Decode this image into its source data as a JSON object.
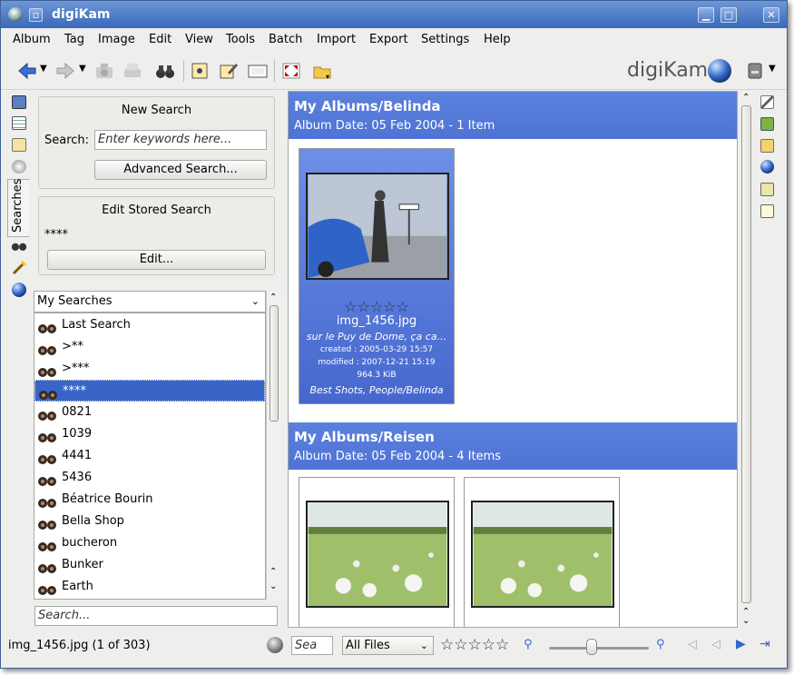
{
  "window": {
    "title": "digiKam"
  },
  "menu": [
    "Album",
    "Tag",
    "Image",
    "Edit",
    "View",
    "Tools",
    "Batch",
    "Import",
    "Export",
    "Settings",
    "Help"
  ],
  "logo": "digiKam",
  "new_search": {
    "title": "New Search",
    "search_label": "Search:",
    "search_placeholder": "Enter keywords here...",
    "advanced_button": "Advanced Search..."
  },
  "stored_search": {
    "title": "Edit Stored Search",
    "name": "****",
    "edit_button": "Edit..."
  },
  "sidebar_tab": "Searches",
  "searches_combo": "My Searches",
  "search_items": [
    {
      "label": "Last Search",
      "selected": false
    },
    {
      "label": ">**",
      "selected": false
    },
    {
      "label": ">***",
      "selected": false
    },
    {
      "label": "****",
      "selected": true
    },
    {
      "label": "0821",
      "selected": false
    },
    {
      "label": "1039",
      "selected": false
    },
    {
      "label": "4441",
      "selected": false
    },
    {
      "label": "5436",
      "selected": false
    },
    {
      "label": "Béatrice Bourin",
      "selected": false
    },
    {
      "label": "Bella Shop",
      "selected": false
    },
    {
      "label": "bucheron",
      "selected": false
    },
    {
      "label": "Bunker",
      "selected": false
    },
    {
      "label": "Earth",
      "selected": false
    }
  ],
  "filter_placeholder": "Search...",
  "albums": [
    {
      "title": "My Albums/Belinda",
      "date": "Album Date: 05 Feb 2004 - 1 Item",
      "item": {
        "filename": "img_1456.jpg",
        "comment": "sur le Puy de Dome, ça ca...",
        "created": "created : 2005-03-29 15:57",
        "modified": "modified : 2007-12-21 15:19",
        "size": "964.3 KiB",
        "tags": "Best Shots, People/Belinda",
        "rating_stars": "☆☆☆☆☆"
      }
    },
    {
      "title": "My Albums/Reisen",
      "date": "Album Date: 05 Feb 2004 - 4 Items"
    }
  ],
  "status": {
    "info": "img_1456.jpg (1 of 303)",
    "search_text": "Sea",
    "filter": "All Files",
    "rating_stars": "☆☆☆☆☆"
  },
  "colors": {
    "title_bar": "#3868ba",
    "selection": "#3a65c8",
    "album_header": "#5779da"
  }
}
